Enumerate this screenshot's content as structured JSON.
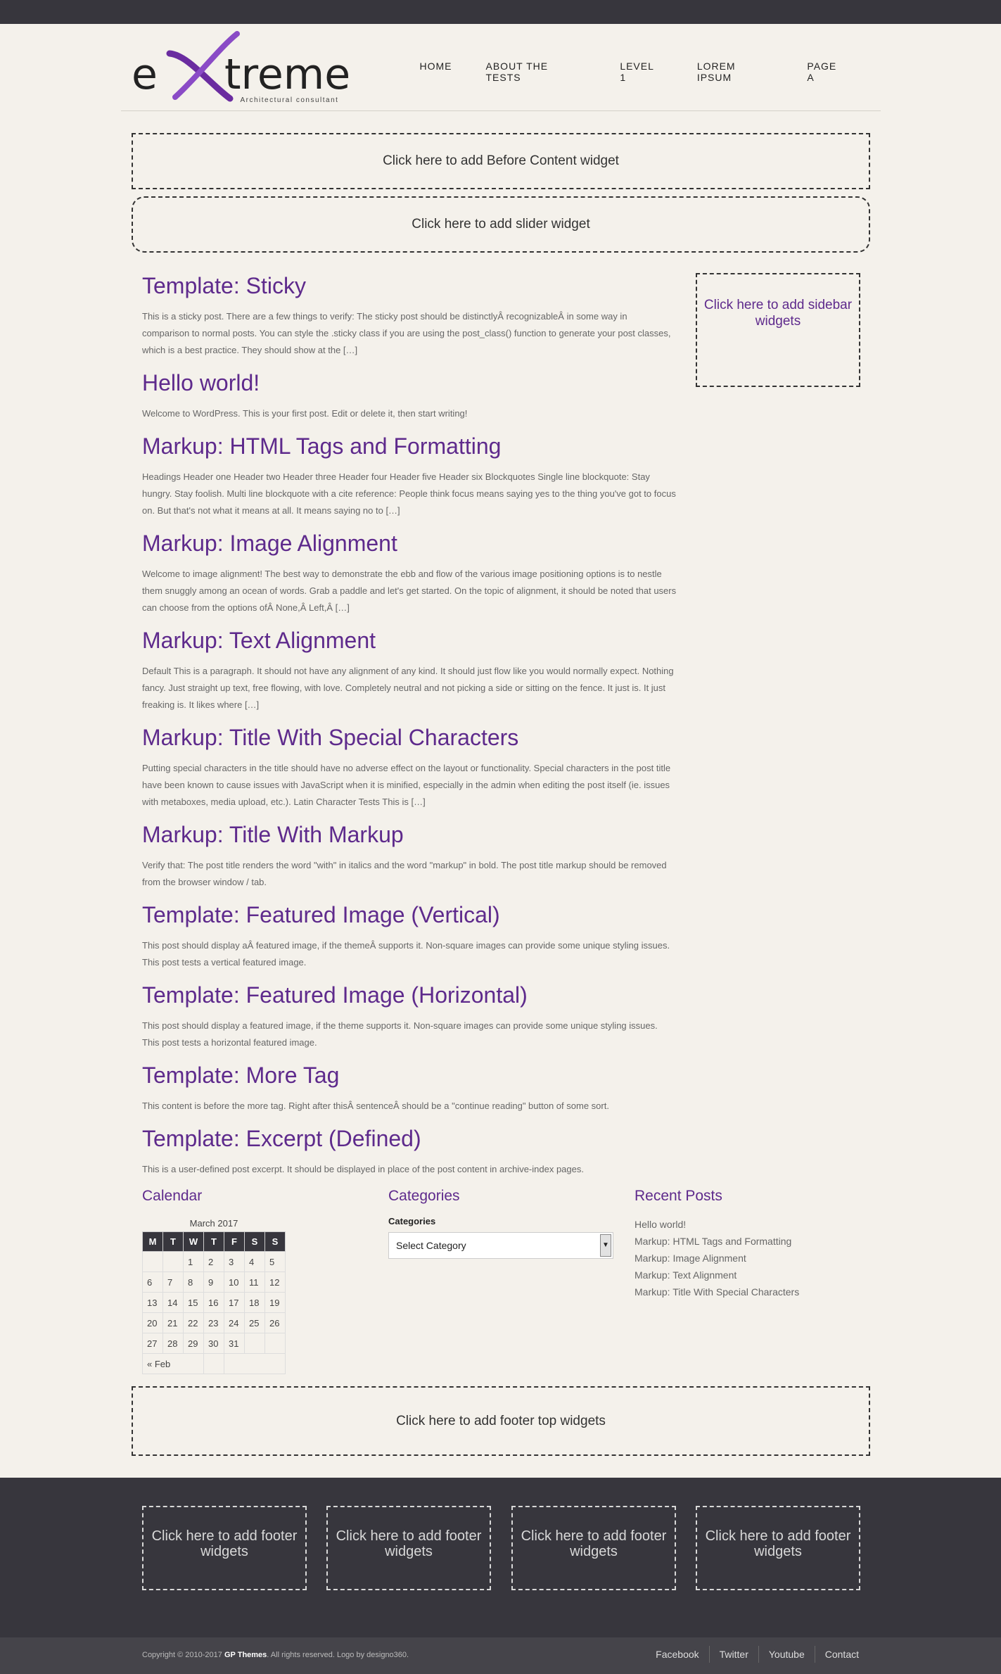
{
  "header": {
    "logo_text": "eXtreme",
    "tagline": "Architectural consultant",
    "nav": [
      "HOME",
      "ABOUT THE TESTS",
      "LEVEL 1",
      "LOREM IPSUM",
      "PAGE A"
    ]
  },
  "widget_areas": {
    "before_content": "Click here to add Before Content widget",
    "slider": "Click here to add slider widget",
    "sidebar": "Click here to add sidebar widgets",
    "footer_top": "Click here to add footer top widgets",
    "footer": "Click here to add footer widgets"
  },
  "posts": [
    {
      "title": "Template: Sticky",
      "excerpt": "This is a sticky post. There are a few things to verify: The sticky post should be distinctlyÂ recognizableÂ in some way in comparison to normal posts. You can style the .sticky class if you are using the post_class() function to generate your post classes, which is a best practice. They should show at the […]"
    },
    {
      "title": "Hello world!",
      "excerpt": "Welcome to WordPress. This is your first post. Edit or delete it, then start writing!"
    },
    {
      "title": "Markup: HTML Tags and Formatting",
      "excerpt": "Headings Header one Header two Header three Header four Header five Header six Blockquotes Single line blockquote: Stay hungry. Stay foolish. Multi line blockquote with a cite reference: People think focus means saying yes to the thing you've got to focus on. But that's not what it means at all. It means saying no to […]"
    },
    {
      "title": "Markup: Image Alignment",
      "excerpt": "Welcome to image alignment! The best way to demonstrate the ebb and flow of the various image positioning options is to nestle them snuggly among an ocean of words. Grab a paddle and let's get started. On the topic of alignment, it should be noted that users can choose from the options ofÂ None,Â Left,Â […]"
    },
    {
      "title": "Markup: Text Alignment",
      "excerpt": "Default This is a paragraph. It should not have any alignment of any kind. It should just flow like you would normally expect. Nothing fancy. Just straight up text, free flowing, with love. Completely neutral and not picking a side or sitting on the fence. It just is. It just freaking is. It likes where […]"
    },
    {
      "title": "Markup: Title With Special Characters",
      "excerpt": "Putting special characters in the title should have no adverse effect on the layout or functionality. Special characters in the post title have been known to cause issues with JavaScript when it is minified, especially in the admin when editing the post itself (ie. issues with metaboxes, media upload, etc.). Latin Character Tests This is […]"
    },
    {
      "title": "Markup: Title With Markup",
      "excerpt": "Verify that: The post title renders the word \"with\" in italics and the word \"markup\" in bold. The post title markup should be removed from the browser window / tab."
    },
    {
      "title": "Template: Featured Image (Vertical)",
      "excerpt": "This post should display aÂ featured image, if the themeÂ supports it. Non-square images can provide some unique styling issues. This post tests a vertical featured image."
    },
    {
      "title": "Template: Featured Image (Horizontal)",
      "excerpt": "This post should display a featured image, if the theme supports it. Non-square images can provide some unique styling issues. This post tests a horizontal featured image."
    },
    {
      "title": "Template: More Tag",
      "excerpt": "This content is before the more tag. Right after thisÂ sentenceÂ should be a \"continue reading\" button of some sort."
    },
    {
      "title": "Template: Excerpt (Defined)",
      "excerpt": "This is a user-defined post excerpt. It should be displayed in place of the post content in archive-index pages."
    }
  ],
  "calendar": {
    "title": "Calendar",
    "caption": "March 2017",
    "days": [
      "M",
      "T",
      "W",
      "T",
      "F",
      "S",
      "S"
    ],
    "weeks": [
      [
        "",
        "",
        "1",
        "2",
        "3",
        "4",
        "5"
      ],
      [
        "6",
        "7",
        "8",
        "9",
        "10",
        "11",
        "12"
      ],
      [
        "13",
        "14",
        "15",
        "16",
        "17",
        "18",
        "19"
      ],
      [
        "20",
        "21",
        "22",
        "23",
        "24",
        "25",
        "26"
      ],
      [
        "27",
        "28",
        "29",
        "30",
        "31",
        "",
        ""
      ]
    ],
    "prev": "« Feb"
  },
  "categories": {
    "title": "Categories",
    "label": "Categories",
    "selected": "Select Category"
  },
  "recent_posts": {
    "title": "Recent Posts",
    "items": [
      "Hello world!",
      "Markup: HTML Tags and Formatting",
      "Markup: Image Alignment",
      "Markup: Text Alignment",
      "Markup: Title With Special Characters"
    ]
  },
  "footer": {
    "copyright_prefix": "Copyright © 2010-2017",
    "copyright_brand": "GP Themes",
    "copyright_suffix": ". All rights reserved. Logo by designo360.",
    "social": [
      "Facebook",
      "Twitter",
      "Youtube",
      "Contact"
    ]
  },
  "colors": {
    "accent": "#5e2a8c",
    "dark": "#37363d",
    "background": "#f4f1eb"
  }
}
